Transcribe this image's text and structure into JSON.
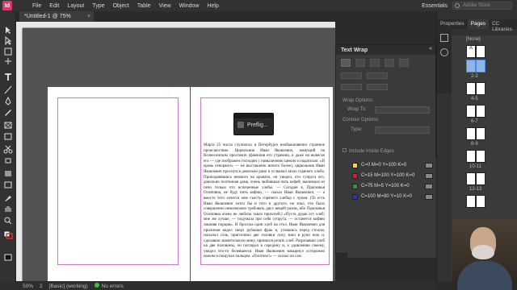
{
  "app": {
    "logo": "Id"
  },
  "menu": [
    "File",
    "Edit",
    "Layout",
    "Type",
    "Object",
    "Table",
    "View",
    "Window",
    "Help"
  ],
  "workspace": "Essentials",
  "search_placeholder": "Adobe Stock",
  "document_tab": {
    "title": "*Untitled-1 @ 75%",
    "close": "×"
  },
  "text_wrap": {
    "title": "Text Wrap",
    "wrap_options_label": "Wrap Options:",
    "wrap_to_label": "Wrap To:",
    "contour_options_label": "Contour Options:",
    "type_label": "Type:",
    "include_inside_edges": "Include Inside Edges"
  },
  "preflight_popup": {
    "label": "Preflig..."
  },
  "right_panel": {
    "tabs": [
      "Properties",
      "Pages",
      "CC Libraries"
    ],
    "active_tab": "Pages",
    "page_labels": [
      "[None]",
      "A",
      "2-3",
      "4-5",
      "6-7",
      "8-9",
      "10-11",
      "12-13"
    ]
  },
  "swatches": [
    {
      "name": "C=0 M=0 Y=100 K=0",
      "color": "#f2e400"
    },
    {
      "name": "C=15 M=100 Y=100 K=0",
      "color": "#d42020"
    },
    {
      "name": "C=75 M=5 Y=100 K=0",
      "color": "#2a9a3a"
    },
    {
      "name": "C=100 M=90 Y=10 K=0",
      "color": "#2a3aa0"
    }
  ],
  "status": {
    "zoom": "50%",
    "page": "2",
    "style": "[Basic] (working)",
    "errors": "No errors"
  },
  "body_text": "Марта 25 числа случилось в Петербурге необыкновенно странное происшествие. Цирюльник Иван Яковлевич, живущий на Вознесенском проспекте (фамилия его утрачена, и даже на вывеске его — где изображен господин с намыленною щекою и надписью: «И кровь отворяют» — не выставлено ничего более), цирюльник Иван Яковлевич проснулся довольно рано и услышал запах горячего хлеба. Приподнявшись немного на кровати, он увидел, что супруга его, довольно почтенная дама, очень любившая пить кофей, вынимала из печи только что испеченные хлебы. — Сегодня я, Прасковья Осиповна, не буду пить кофию, — сказал Иван Яковлевич, — а вместо того хочется мне съесть горячего хлебца с луком. (То есть Иван Яковлевич хотел бы и того и другого, но знал, что было совершенно невозможно требовать двух вещей разом, ибо Прасковья Осиповна очень не любила таких прихотей.) «Пусть дурак ест хлеб; мне же лучше, — подумала про себя супруга, — останется кофию лишняя порция». И бросила один хлеб на стол. Иван Яковлевич для приличия надел сверх рубашки фрак и, усевшись перед столом, насыпал соль, приготовил две головки луку, взял в руки нож и, сделавши значительную мину, принялся резать хлеб. Разрезавши хлеб на две половины, он поглядел в середину и, к удивлению своему, увидел что-то белевшееся. Иван Яковлевич ковырнул осторожно ножом и пощупал пальцем. «Плотное!» — сказал он сам"
}
